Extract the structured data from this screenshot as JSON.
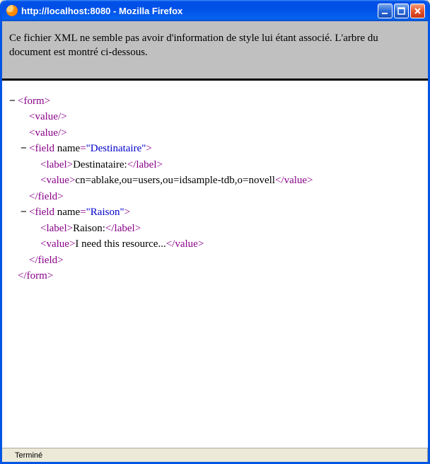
{
  "window": {
    "title": "http://localhost:8080 - Mozilla Firefox"
  },
  "notice": "Ce fichier XML ne semble pas avoir d'information de style lui étant associé. L'arbre du document est montré ci-dessous.",
  "xml": {
    "root_open": "<form>",
    "root_close": "</form>",
    "value_empty": "<value/>",
    "field1": {
      "open_pre": "<field ",
      "attr_name": "name",
      "attr_val": "\"Destinataire\"",
      "open_post": ">",
      "label_open": "<label>",
      "label_text": "Destinataire:",
      "label_close": "</label>",
      "value_open": "<value>",
      "value_text": "cn=ablake,ou=users,ou=idsample-tdb,o=novell",
      "value_close": "</value>",
      "close": "</field>"
    },
    "field2": {
      "open_pre": "<field ",
      "attr_name": "name",
      "attr_val": "\"Raison\"",
      "open_post": ">",
      "label_open": "<label>",
      "label_text": "Raison:",
      "label_close": "</label>",
      "value_open": "<value>",
      "value_text": "I need this resource...",
      "value_close": "</value>",
      "close": "</field>"
    }
  },
  "status": "Terminé",
  "toggle": "−"
}
